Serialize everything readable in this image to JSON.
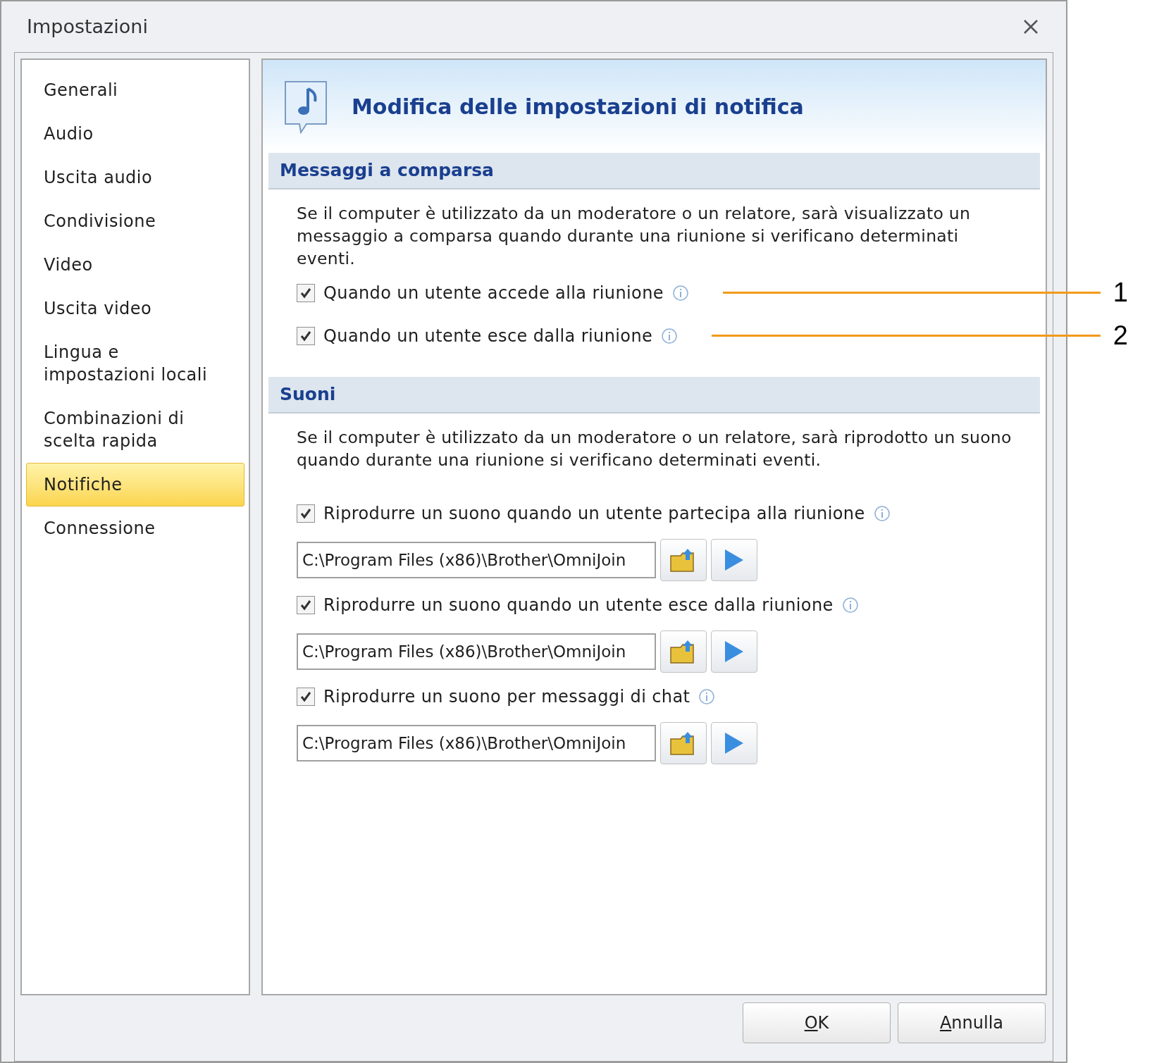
{
  "window": {
    "title": "Impostazioni"
  },
  "sidebar": {
    "items": [
      {
        "label": "Generali",
        "selected": false
      },
      {
        "label": "Audio",
        "selected": false
      },
      {
        "label": "Uscita audio",
        "selected": false
      },
      {
        "label": "Condivisione",
        "selected": false
      },
      {
        "label": "Video",
        "selected": false
      },
      {
        "label": "Uscita video",
        "selected": false
      },
      {
        "label": "Lingua e impostazioni locali",
        "selected": false
      },
      {
        "label": "Combinazioni di scelta rapida",
        "selected": false
      },
      {
        "label": "Notifiche",
        "selected": true
      },
      {
        "label": "Connessione",
        "selected": false
      }
    ]
  },
  "header": {
    "title": "Modifica delle impostazioni di notifica"
  },
  "sections": [
    {
      "title": "Messaggi a comparsa",
      "description": "Se il computer è utilizzato da un moderatore o un relatore, sarà visualizzato un messaggio a comparsa quando durante una riunione si verificano determinati eventi.",
      "options": [
        {
          "label": "Quando un utente accede alla riunione",
          "checked": true,
          "callout": "1"
        },
        {
          "label": "Quando un utente esce dalla riunione",
          "checked": true,
          "callout": "2"
        }
      ]
    },
    {
      "title": "Suoni",
      "description": "Se il computer è utilizzato da un moderatore o un relatore, sarà riprodotto un suono quando durante una riunione si verificano determinati eventi.",
      "options": [
        {
          "label": "Riprodurre un suono quando un utente partecipa alla riunione",
          "checked": true,
          "path": "C:\\Program Files (x86)\\Brother\\OmniJoin"
        },
        {
          "label": "Riprodurre un suono quando un utente esce dalla riunione",
          "checked": true,
          "path": "C:\\Program Files (x86)\\Brother\\OmniJoin"
        },
        {
          "label": "Riprodurre un suono per messaggi di chat",
          "checked": true,
          "path": "C:\\Program Files (x86)\\Brother\\OmniJoin"
        }
      ]
    }
  ],
  "buttons": [
    "OK",
    "Annulla"
  ]
}
